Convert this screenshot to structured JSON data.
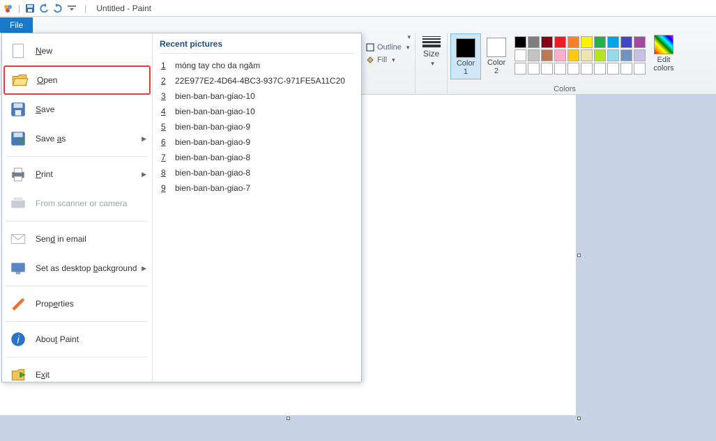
{
  "titlebar": {
    "title": "Untitled - Paint"
  },
  "tabs": {
    "file": "File"
  },
  "ribbon": {
    "outline": "Outline",
    "fill": "Fill",
    "size": "Size",
    "color1": "Color\n1",
    "color2": "Color\n2",
    "editcolors": "Edit\ncolors",
    "colors_label": "Colors",
    "swatches_row1": [
      "#000000",
      "#7f7f7f",
      "#880015",
      "#ed1c24",
      "#ff7f27",
      "#fff200",
      "#22b14c",
      "#00a2e8",
      "#3f48cc",
      "#a349a4"
    ],
    "swatches_row2": [
      "#ffffff",
      "#c3c3c3",
      "#b97a57",
      "#ffaec9",
      "#ffc90e",
      "#efe4b0",
      "#b5e61d",
      "#99d9ea",
      "#7092be",
      "#c8bfe7"
    ],
    "swatches_row3": [
      "",
      "",
      "",
      "",
      "",
      "",
      "",
      "",
      "",
      ""
    ]
  },
  "color1_value": "#000000",
  "color2_value": "#ffffff",
  "filemenu": {
    "new": "New",
    "open": "Open",
    "save": "Save",
    "saveas": "Save as",
    "print": "Print",
    "scanner": "From scanner or camera",
    "email": "Send in email",
    "desktop": "Set as desktop background",
    "properties": "Properties",
    "about": "About Paint",
    "exit": "Exit"
  },
  "recent": {
    "header": "Recent pictures",
    "items": [
      "móng tay cho da ngăm",
      "22E977E2-4D64-4BC3-937C-971FE5A11C20",
      "bien-ban-ban-giao-10",
      "bien-ban-ban-giao-10",
      "bien-ban-ban-giao-9",
      "bien-ban-ban-giao-9",
      "bien-ban-ban-giao-8",
      "bien-ban-ban-giao-8",
      "bien-ban-ban-giao-7"
    ]
  }
}
